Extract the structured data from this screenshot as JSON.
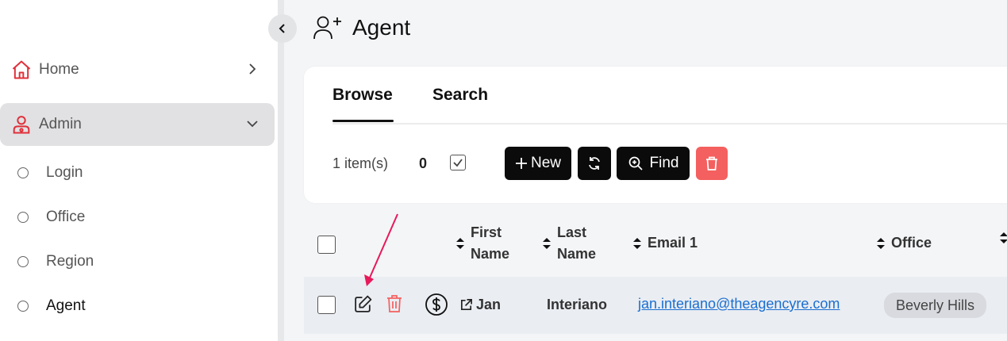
{
  "sidebar": {
    "items": [
      {
        "label": "Home",
        "icon": "home-icon"
      },
      {
        "label": "Admin",
        "icon": "admin-user-icon"
      }
    ],
    "sub_items": [
      {
        "label": "Login"
      },
      {
        "label": "Office"
      },
      {
        "label": "Region"
      },
      {
        "label": "Agent"
      }
    ]
  },
  "header": {
    "title": "Agent",
    "icon": "user-plus-icon"
  },
  "tabs": [
    {
      "label": "Browse"
    },
    {
      "label": "Search"
    }
  ],
  "toolbar": {
    "items_text": "1 item(s)",
    "selected_count": "0",
    "new_label": "New",
    "find_label": "Find"
  },
  "table": {
    "columns": [
      {
        "line1": "First",
        "line2": "Name"
      },
      {
        "line1": "Last",
        "line2": "Name"
      },
      {
        "line1": "Email 1"
      },
      {
        "line1": "Office"
      }
    ],
    "rows": [
      {
        "first_name": "Jan",
        "last_name": "Interiano",
        "email": "jan.interiano@theagencyre.com",
        "office": "Beverly Hills"
      }
    ]
  },
  "colors": {
    "accent_red": "#e0303a",
    "delete_red": "#f4605f",
    "link_blue": "#1a6fd1",
    "arrow_pink": "#e8195a"
  }
}
